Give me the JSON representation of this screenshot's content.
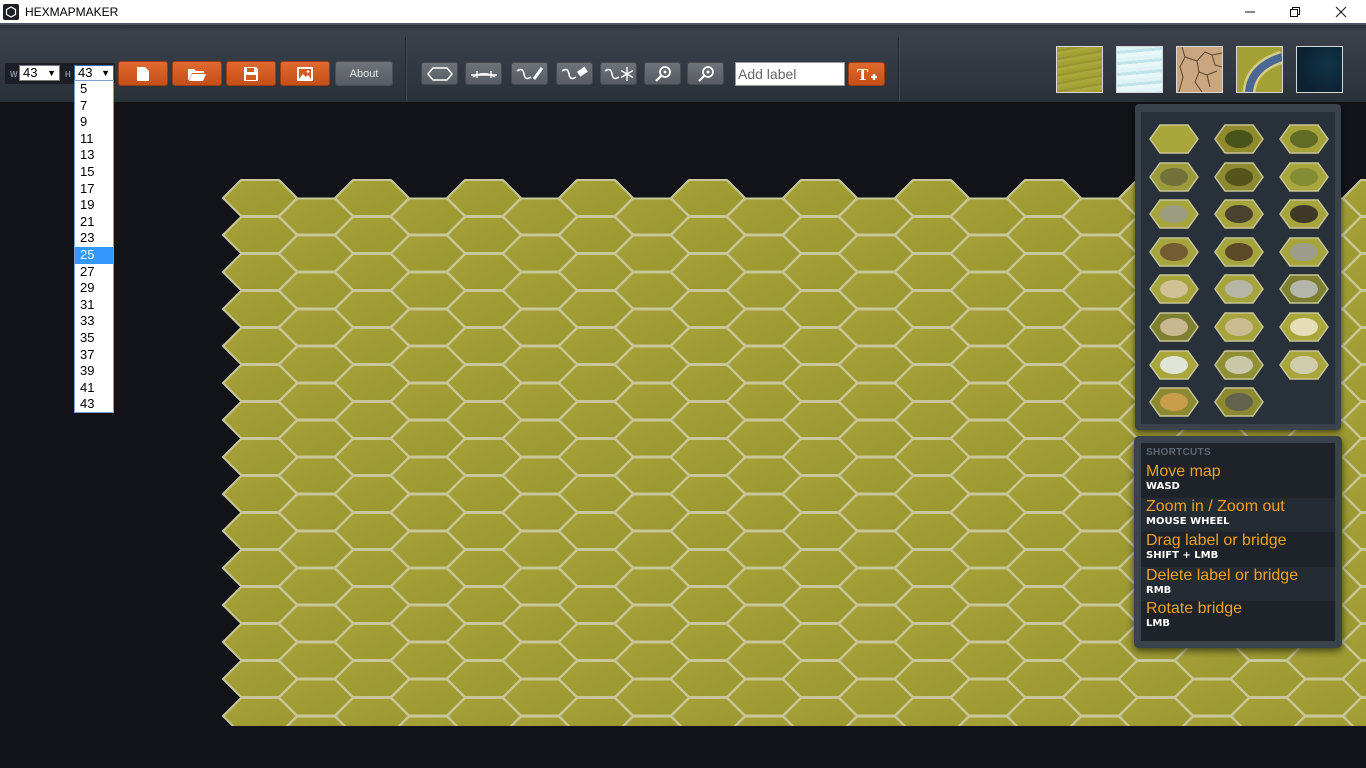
{
  "window": {
    "title": "HEXMAPMAKER",
    "app_icon": "hexagon-icon",
    "controls": [
      "minimize",
      "restore",
      "close"
    ]
  },
  "toolbar": {
    "width_label": "W",
    "width_value": "43",
    "height_label": "H",
    "height_value": "43",
    "buttons": [
      {
        "name": "new-map",
        "icon": "new-file-icon"
      },
      {
        "name": "open-map",
        "icon": "folder-icon"
      },
      {
        "name": "save-map",
        "icon": "floppy-disk-icon"
      },
      {
        "name": "export-image",
        "icon": "image-icon"
      }
    ],
    "about_label": "About",
    "tools": [
      {
        "name": "hex-tool",
        "icon": "hexagon-icon"
      },
      {
        "name": "bridge-tool",
        "icon": "bridge-icon"
      },
      {
        "name": "draw-river-tool",
        "icon": "river-pen-icon"
      },
      {
        "name": "erase-river-tool",
        "icon": "river-eraser-icon"
      },
      {
        "name": "frozen-river-tool",
        "icon": "river-snowflake-icon"
      },
      {
        "name": "zoom-in-tool",
        "icon": "zoom-in-icon"
      },
      {
        "name": "zoom-out-tool",
        "icon": "zoom-out-icon"
      }
    ],
    "label_input_placeholder": "Add label",
    "label_input_value": "",
    "add_label_button_icon": "add-text-icon",
    "add_label_button_text": "T+",
    "textures": [
      {
        "name": "grass",
        "color": "#a3a034"
      },
      {
        "name": "snow-ice",
        "color": "#cfe9ef"
      },
      {
        "name": "desert-cracked",
        "color": "#c9a57e"
      },
      {
        "name": "river",
        "color": "#8f9a45"
      },
      {
        "name": "deep-water",
        "color": "#0d2a3a"
      }
    ]
  },
  "height_dropdown": {
    "options": [
      "5",
      "7",
      "9",
      "11",
      "13",
      "15",
      "17",
      "19",
      "21",
      "23",
      "25",
      "27",
      "29",
      "31",
      "33",
      "35",
      "37",
      "39",
      "41",
      "43"
    ],
    "highlighted": "25"
  },
  "tiles_palette": {
    "tiles": [
      "plain-grass",
      "dense-forest",
      "forest",
      "grassland-ruins",
      "forest-hill",
      "hill",
      "mountain",
      "skull-mountain",
      "volcano",
      "cave",
      "dark-cave",
      "mountain-fortress",
      "castle-town",
      "stone-castle",
      "forest-castle",
      "forest-castle-town",
      "mountain-castle",
      "tower",
      "magic-beacon",
      "forest-stone-circle",
      "stone-circle",
      "village-roads",
      "town"
    ]
  },
  "shortcuts": {
    "heading": "SHORTCUTS",
    "items": [
      {
        "action": "Move map",
        "keys": "WASD"
      },
      {
        "action": "Zoom in / Zoom out",
        "keys": "MOUSE WHEEL"
      },
      {
        "action": "Drag label or bridge",
        "keys": "SHIFT + LMB"
      },
      {
        "action": "Delete label or bridge",
        "keys": "RMB"
      },
      {
        "action": "Rotate bridge",
        "keys": "LMB"
      }
    ]
  },
  "map": {
    "terrain": "grass",
    "colors": {
      "fill": "#a09c33",
      "border": "#c9c79a",
      "background": "#111318"
    }
  }
}
